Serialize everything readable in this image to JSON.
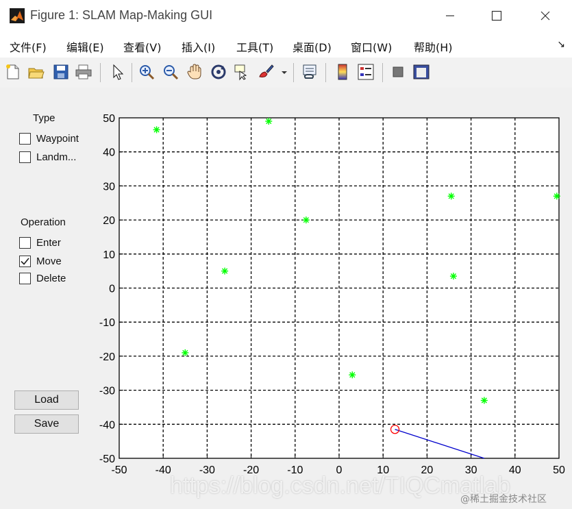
{
  "window": {
    "title": "Figure 1: SLAM Map-Making GUI",
    "controls": [
      "minimize",
      "maximize",
      "close"
    ]
  },
  "menu": {
    "items": [
      "文件(F)",
      "编辑(E)",
      "查看(V)",
      "插入(I)",
      "工具(T)",
      "桌面(D)",
      "窗口(W)",
      "帮助(H)"
    ],
    "overflow_arrow": "↘"
  },
  "toolbar": {
    "icons": [
      "new-file-icon",
      "open-folder-icon",
      "save-icon",
      "print-icon",
      "pointer-icon",
      "zoom-in-icon",
      "zoom-out-icon",
      "pan-hand-icon",
      "rotate-3d-icon",
      "data-cursor-icon",
      "brush-icon",
      "link-plot-icon",
      "colorbar-icon",
      "legend-icon",
      "hide-plot-tools-icon",
      "show-plot-tools-icon"
    ]
  },
  "panel": {
    "type_label": "Type",
    "type_options": [
      {
        "label": "Waypoint",
        "checked": false
      },
      {
        "label": "Landm...",
        "checked": false
      }
    ],
    "operation_label": "Operation",
    "operation_options": [
      {
        "label": "Enter",
        "checked": false
      },
      {
        "label": "Move",
        "checked": true
      },
      {
        "label": "Delete",
        "checked": false
      }
    ],
    "load_label": "Load",
    "save_label": "Save"
  },
  "watermark": {
    "url": "https://blog.csdn.net/TIQCmatlab",
    "corner": "@稀土掘金技术社区"
  },
  "chart_data": {
    "type": "scatter",
    "xlim": [
      -50,
      50
    ],
    "ylim": [
      -50,
      50
    ],
    "xticks": [
      -50,
      -40,
      -30,
      -20,
      -10,
      0,
      10,
      20,
      30,
      40,
      50
    ],
    "yticks": [
      -50,
      -40,
      -30,
      -20,
      -10,
      0,
      10,
      20,
      30,
      40,
      50
    ],
    "grid": true,
    "grid_style": "dashed",
    "colors": {
      "landmarks": "#00ff00",
      "robot": "#ff0000",
      "path": "#0000cc"
    },
    "landmarks": [
      {
        "x": -41.5,
        "y": 46.5
      },
      {
        "x": -16,
        "y": 49
      },
      {
        "x": -7.5,
        "y": 20
      },
      {
        "x": -26,
        "y": 5
      },
      {
        "x": -35,
        "y": -19
      },
      {
        "x": 3,
        "y": -25.5
      },
      {
        "x": 25.5,
        "y": 27
      },
      {
        "x": 26,
        "y": 3.5
      },
      {
        "x": 49.5,
        "y": 27
      },
      {
        "x": 33,
        "y": -33
      }
    ],
    "robot": {
      "x": 12.7,
      "y": -41.5
    },
    "path": [
      {
        "x": 12.7,
        "y": -41.5
      },
      {
        "x": 33,
        "y": -50
      }
    ]
  }
}
